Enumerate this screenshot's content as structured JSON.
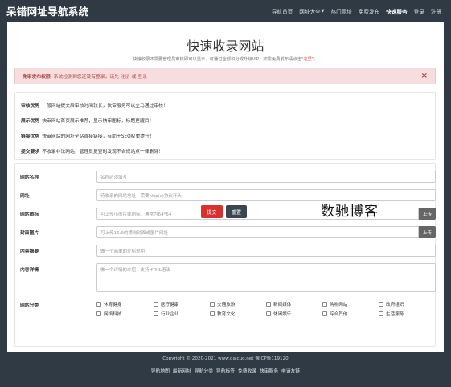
{
  "site": {
    "logo": "呆错网址导航系统"
  },
  "nav": {
    "items": [
      {
        "label": "导航首页"
      },
      {
        "label": "网址大全"
      },
      {
        "label": "热门网址"
      },
      {
        "label": "免费发布"
      },
      {
        "label": "快速服务"
      },
      {
        "label": "登录"
      },
      {
        "label": "注册"
      }
    ]
  },
  "header": {
    "title": "快速收录网站",
    "subtitle_pre": "快速收录不需要管理员审核即可以显示，可通过全部积分或升级VIP，如需免费发布请点击",
    "subtitle_link": "\"这里\"",
    "subtitle_post": "。"
  },
  "alert": {
    "strong": "免审发布权限",
    "text": "系统检测到您还没有登录，请先",
    "link1": "注册",
    "or": "或",
    "link2": "登录",
    "close": "×"
  },
  "info": [
    {
      "title": "审核优势",
      "text": "一般网站提交后审核时间较长，快审服务可以立马通过审核！"
    },
    {
      "title": "展示优势",
      "text": "快审网站首页展示推荐，显示快审图标，标题更醒目！"
    },
    {
      "title": "链接优势",
      "text": "快审网站的网址全站直接链接，有助于SEO权重提升！"
    },
    {
      "title": "提交要求",
      "text": "不收录非法网站，管理员复查时发现不合规站点一律删除！"
    }
  ],
  "form": {
    "name_label": "网站名称",
    "name_placeholder": "名称必须填写",
    "url_label": "网址",
    "url_placeholder": "待收录的网站地址，需要http(s)协议开头",
    "icon_label": "网站图标",
    "icon_placeholder": "可上传小图片或图标，通常为64*64",
    "icon_upload": "上传",
    "cover_label": "封面图片",
    "cover_placeholder": "可上传16:9的横向封面或图片网址",
    "cover_upload": "上传",
    "summary_label": "内容摘要",
    "summary_placeholder": "做一个简单的介绍说明",
    "detail_label": "内容详情",
    "detail_placeholder": "做一个详情的介绍，支持HTML语法",
    "category_label": "网站分类",
    "categories": [
      "休育健身",
      "医疗健康",
      "交通旅游",
      "新闻媒体",
      "购物网站",
      "政府组织",
      "网络科技",
      "行业企业",
      "教育文化",
      "休闲娱乐",
      "综合其他",
      "生活服务"
    ],
    "submit": "提交",
    "reset": "重置"
  },
  "watermark": "数驰博客",
  "footer": {
    "copyright": "Copyright © 2020-2021 www.daicuo.net 豫ICP备119120",
    "links": [
      "导航地图",
      "最新网址",
      "导航分类",
      "导航标签",
      "免费收录",
      "快审服务",
      "申请友链"
    ]
  }
}
